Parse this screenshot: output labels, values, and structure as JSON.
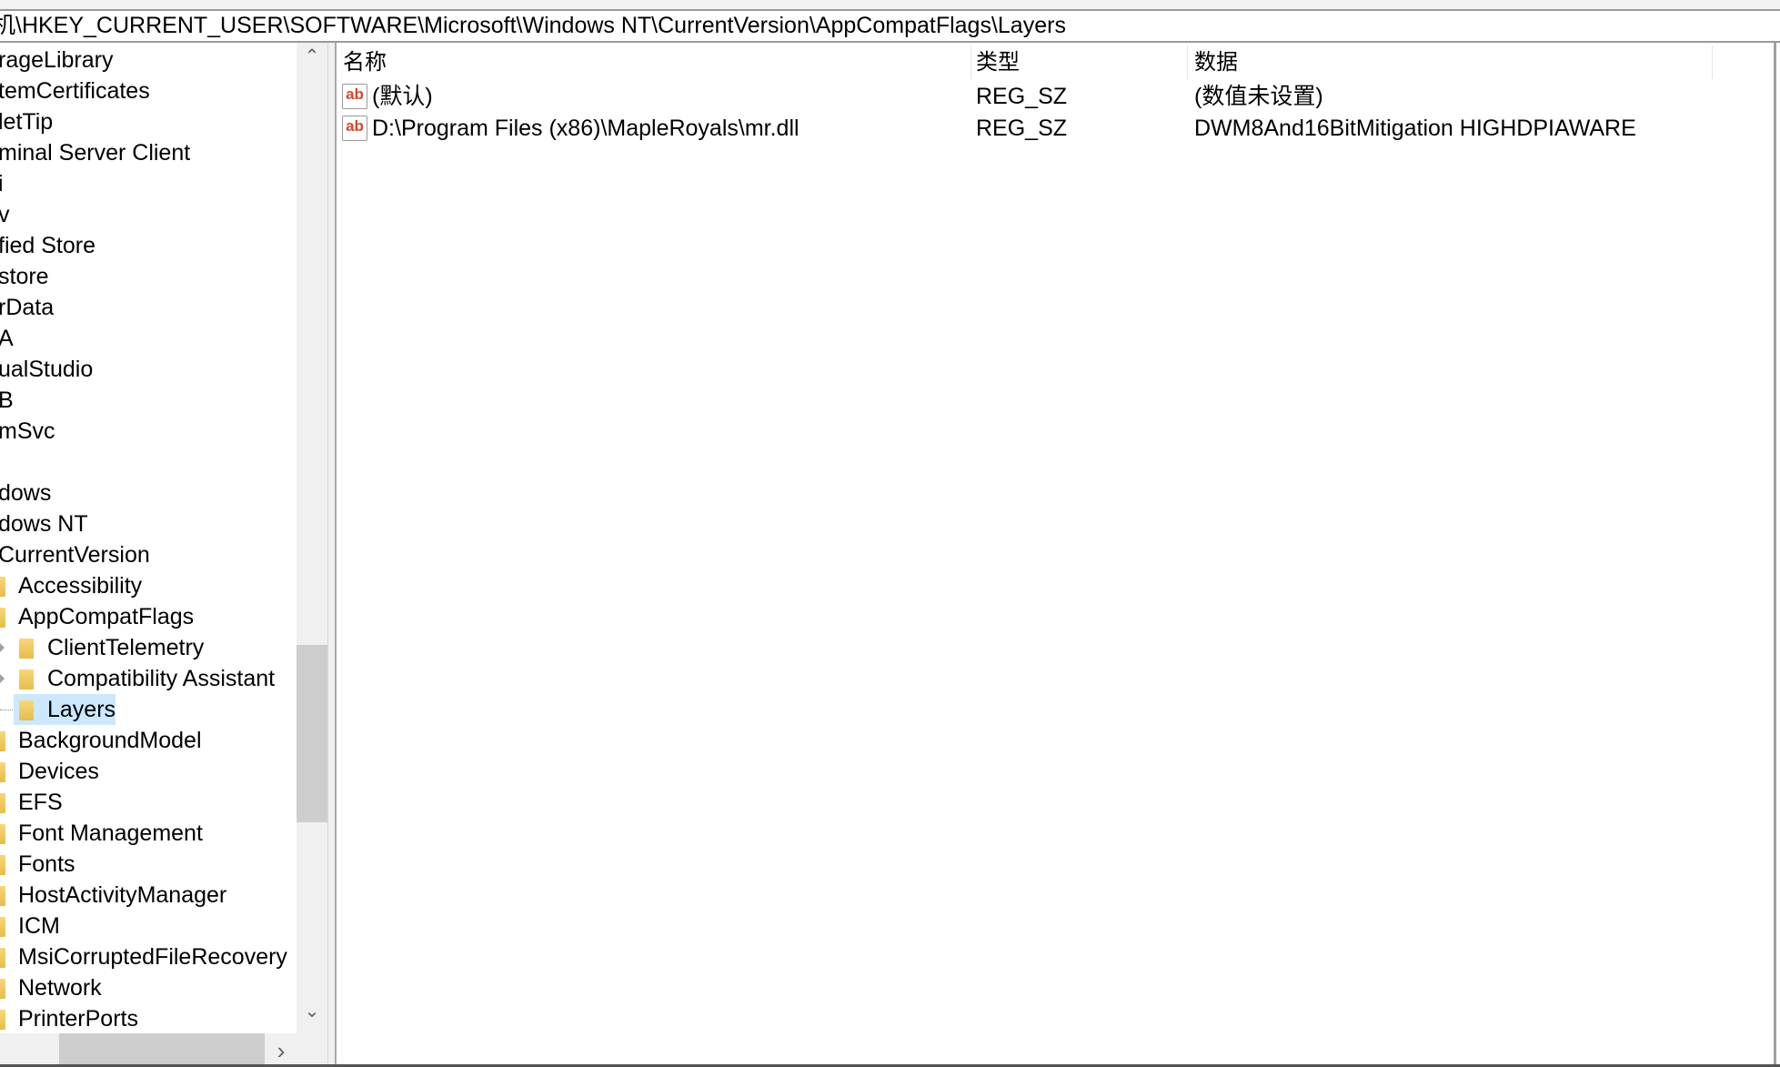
{
  "address_bar": {
    "path": "机\\HKEY_CURRENT_USER\\SOFTWARE\\Microsoft\\Windows NT\\CurrentVersion\\AppCompatFlags\\Layers"
  },
  "tree": {
    "items": [
      {
        "label": "rageLibrary",
        "level": 0
      },
      {
        "label": "temCertificates",
        "level": 0
      },
      {
        "label": "letTip",
        "level": 0
      },
      {
        "label": "minal Server Client",
        "level": 0
      },
      {
        "label": "i",
        "level": 0
      },
      {
        "label": "v",
        "level": 0
      },
      {
        "label": "fied Store",
        "level": 0
      },
      {
        "label": "store",
        "level": 0
      },
      {
        "label": "rData",
        "level": 0
      },
      {
        "label": "A",
        "level": 0
      },
      {
        "label": "ualStudio",
        "level": 0
      },
      {
        "label": "B",
        "level": 0
      },
      {
        "label": "mSvc",
        "level": 0
      },
      {
        "label": "",
        "level": 0
      },
      {
        "label": "dows",
        "level": 0
      },
      {
        "label": "dows NT",
        "level": 0
      },
      {
        "label": "CurrentVersion",
        "level": 0
      },
      {
        "label": "Accessibility",
        "level": 1
      },
      {
        "label": "AppCompatFlags",
        "level": 1
      },
      {
        "label": "ClientTelemetry",
        "level": 2,
        "expandable": true
      },
      {
        "label": "Compatibility Assistant",
        "level": 2,
        "expandable": true
      },
      {
        "label": "Layers",
        "level": 2,
        "selected": true
      },
      {
        "label": "BackgroundModel",
        "level": 1
      },
      {
        "label": "Devices",
        "level": 1
      },
      {
        "label": "EFS",
        "level": 1
      },
      {
        "label": "Font Management",
        "level": 1
      },
      {
        "label": "Fonts",
        "level": 1
      },
      {
        "label": "HostActivityManager",
        "level": 1
      },
      {
        "label": "ICM",
        "level": 1
      },
      {
        "label": "MsiCorruptedFileRecovery",
        "level": 1
      },
      {
        "label": "Network",
        "level": 1
      },
      {
        "label": "PrinterPorts",
        "level": 1
      }
    ]
  },
  "list": {
    "columns": [
      "名称",
      "类型",
      "数据"
    ],
    "rows": [
      {
        "name": "(默认)",
        "type": "REG_SZ",
        "data": "(数值未设置)",
        "icon": "string-value-icon"
      },
      {
        "name": "D:\\Program Files (x86)\\MapleRoyals\\mr.dll",
        "type": "REG_SZ",
        "data": "DWM8And16BitMitigation HIGHDPIAWARE",
        "icon": "string-value-icon"
      }
    ]
  },
  "icons": {
    "scroll_up": "⌃",
    "scroll_down": "⌄",
    "scroll_right": "›",
    "value_icon_text": "ab"
  },
  "colors": {
    "selection": "#cce8ff",
    "folder": "#e8bc4a",
    "value_icon": "#d4472c"
  }
}
